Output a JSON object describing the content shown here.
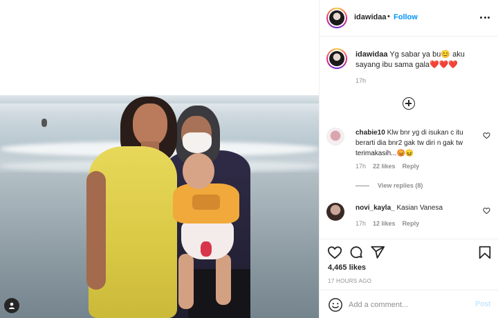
{
  "post": {
    "username": "idawidaa",
    "follow_label": "Follow",
    "separator": "•",
    "more_icon": "more-horizontal-icon"
  },
  "caption": {
    "username": "idawidaa",
    "text": "Yg sabar ya bu😊 aku sayang ibu sama gala❤️❤️❤️",
    "time": "17h"
  },
  "load_more_icon": "plus-circle-icon",
  "comments": [
    {
      "username": "chabie10",
      "text": "Klw bnr yg di isukan c itu berarti dia bnr2 gak tw diri n gak tw terimakasih...😡😖",
      "time": "17h",
      "likes": "22 likes",
      "reply": "Reply"
    },
    {
      "username": "novi_kayla_",
      "text": "Kasian Vanesa",
      "time": "17h",
      "likes": "12 likes",
      "reply": "Reply"
    }
  ],
  "view_replies": "View replies (8)",
  "actions": {
    "like_icon": "heart-icon",
    "comment_icon": "comment-icon",
    "share_icon": "send-icon",
    "save_icon": "bookmark-icon"
  },
  "likes_count": "4,465 likes",
  "post_time": "17 HOURS AGO",
  "add_comment": {
    "placeholder": "Add a comment...",
    "post_label": "Post",
    "emoji_icon": "emoji-icon"
  },
  "colors": {
    "accent": "#0095f6",
    "post_disabled": "#b2dffc",
    "text": "#262626",
    "muted": "#8e8e8e"
  }
}
